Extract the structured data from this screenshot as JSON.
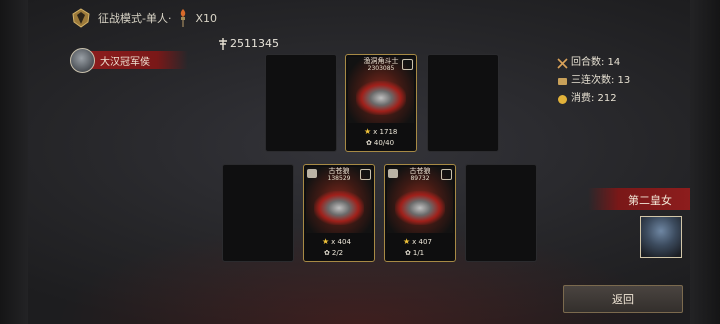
{
  "header": {
    "mode_title": "征战模式-单人·",
    "multiplier": "X10"
  },
  "player": {
    "name": "大汉冠军侯",
    "power": "2511345"
  },
  "stats": {
    "rounds": "回合数: 14",
    "triple_streak": "三连次数: 13",
    "consume": "消费: 212"
  },
  "cards": [
    {
      "name": "渔洞角斗士",
      "power": "2303085",
      "stars": "x 1718",
      "count": "40/40"
    },
    {
      "name": "古苍狼",
      "power": "138529",
      "stars": "x 404",
      "count": "2/2"
    },
    {
      "name": "古苍狼",
      "power": "89732",
      "stars": "x 407",
      "count": "1/1"
    }
  ],
  "opponent": {
    "name": "第二皇女"
  },
  "back_button": "返回",
  "colors": {
    "accent_red": "#8d1d1d",
    "card_border": "#a78a45",
    "star": "#f2c43a"
  }
}
